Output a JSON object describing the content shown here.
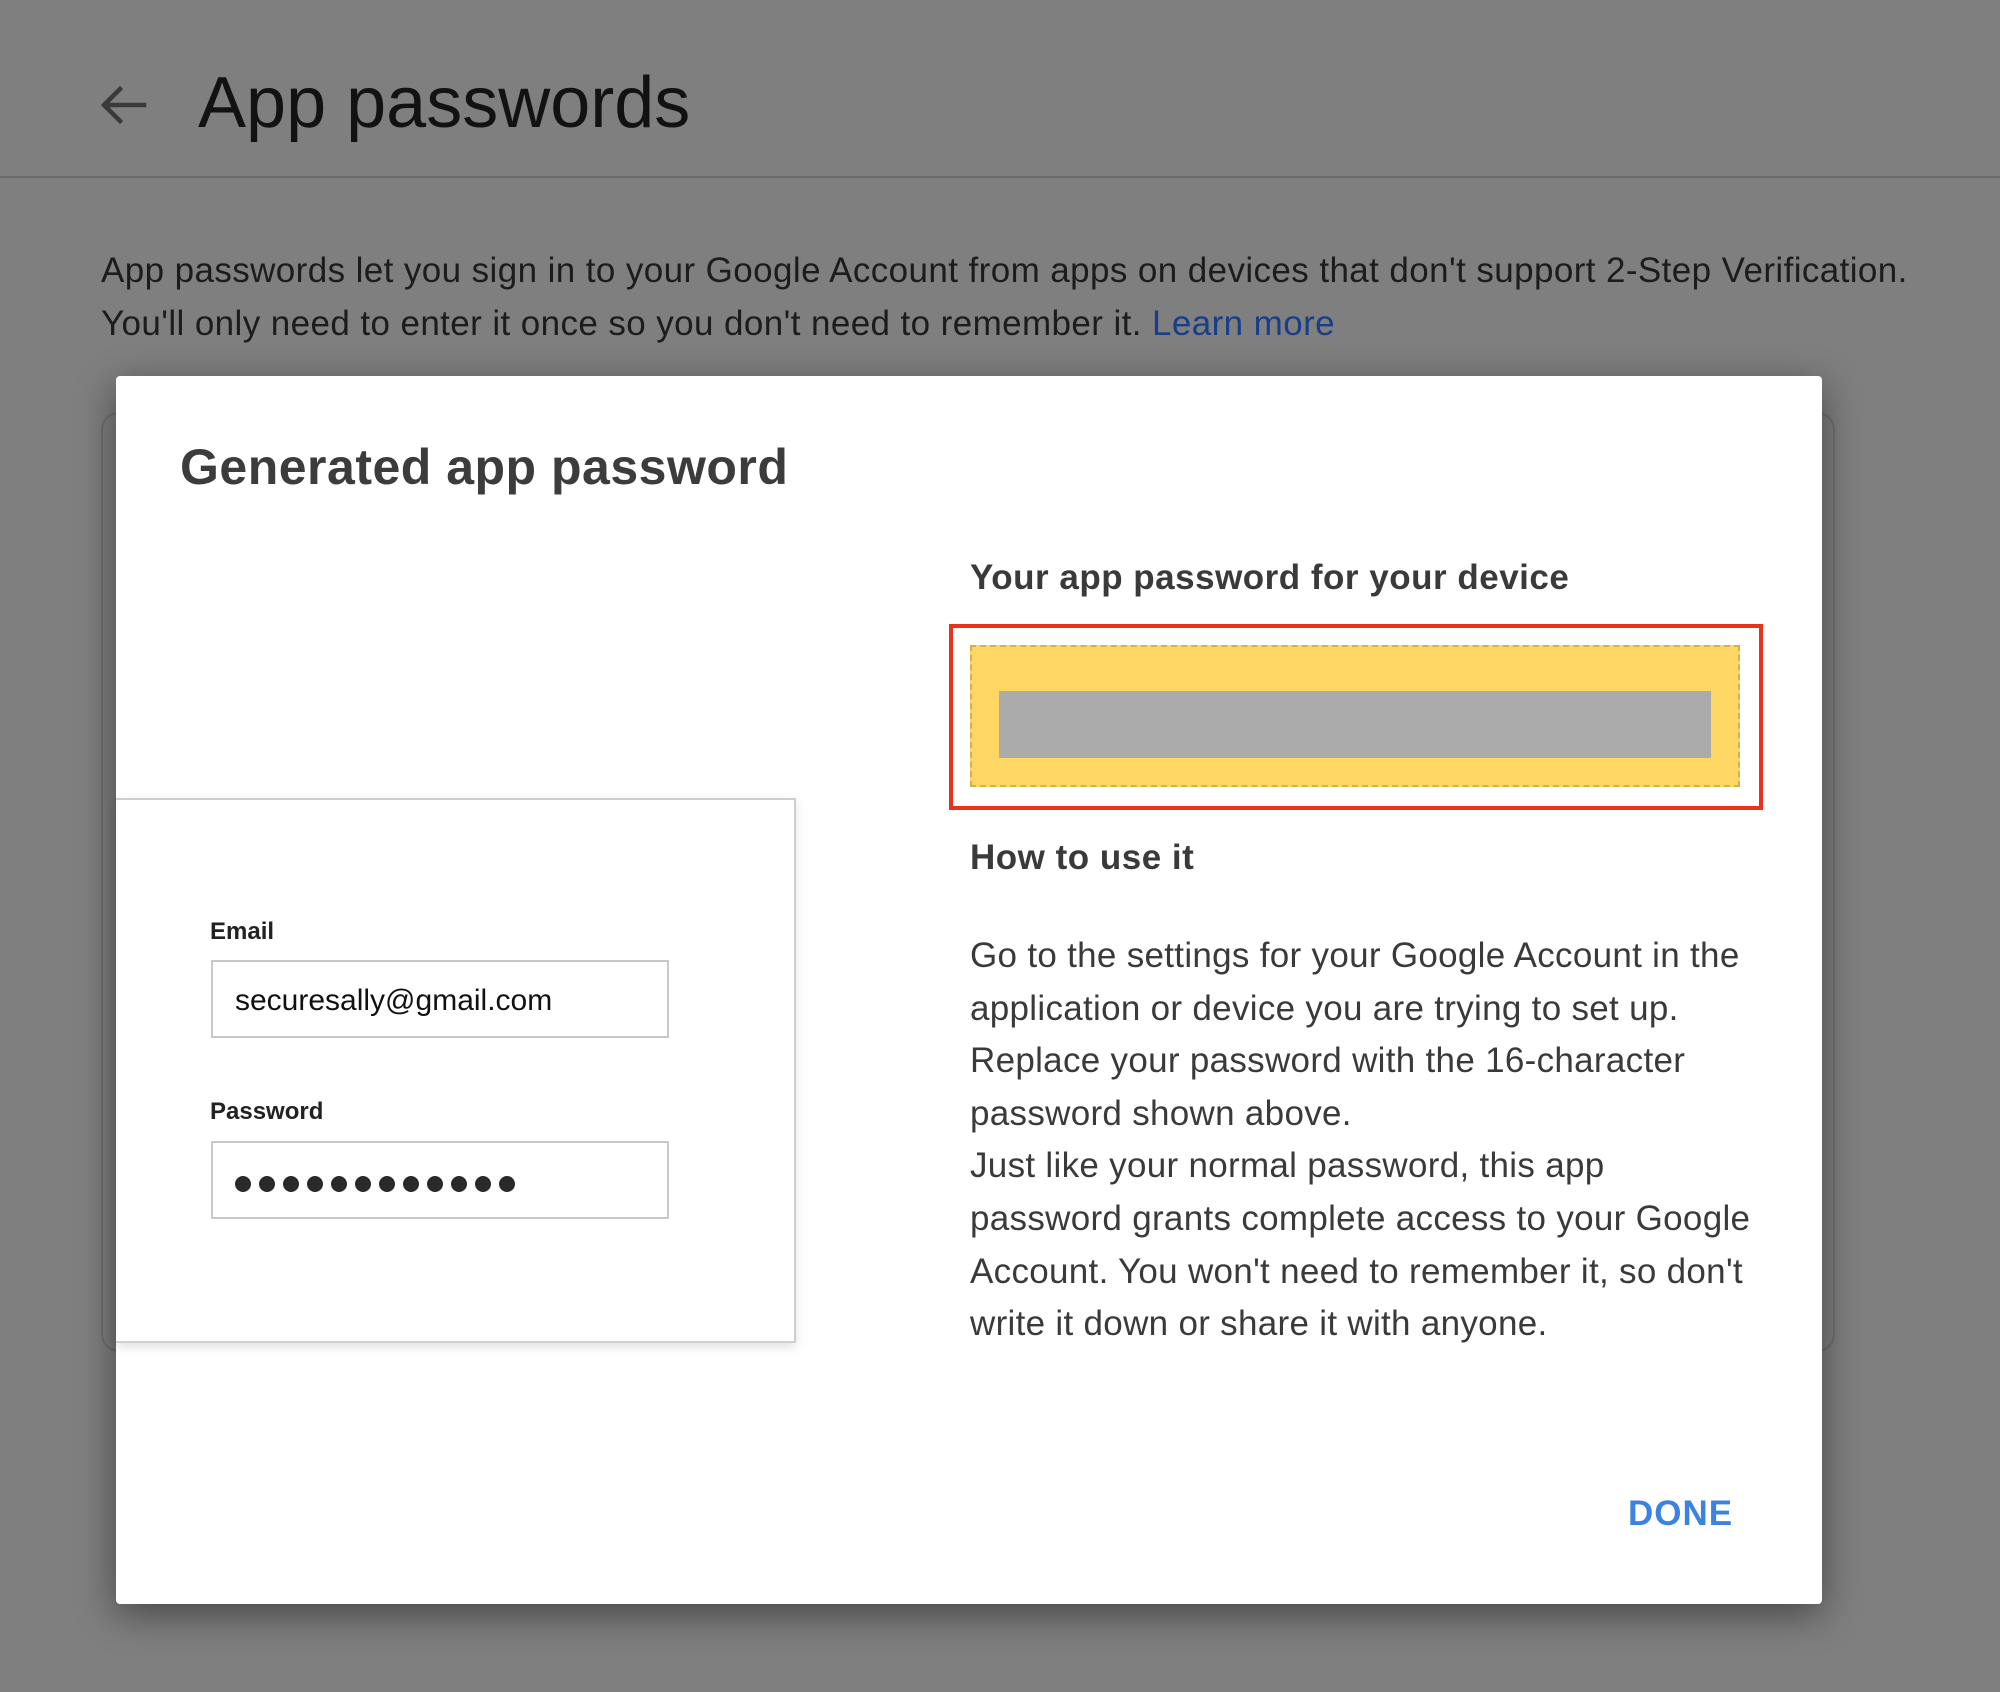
{
  "header": {
    "back_icon": "arrow-left-icon",
    "title": "App passwords"
  },
  "intro": {
    "text": "App passwords let you sign in to your Google Account from apps on devices that don't support 2-Step Verification. You'll only need to enter it once so you don't need to remember it.",
    "link_label": "Learn more"
  },
  "dialog": {
    "title": "Generated app password",
    "illustration": {
      "email_label": "Email",
      "email_value": "securesally@gmail.com",
      "password_label": "Password",
      "password_dot_count": 12
    },
    "password_heading": "Your app password for your device",
    "password_box": {
      "fill_color": "#fdd663",
      "highlight_color": "#e8321e",
      "value_redacted": true
    },
    "how_heading": "How to use it",
    "how_paragraph_1": "Go to the settings for your Google Account in the application or device you are trying to set up. Replace your password with the 16-character password shown above.",
    "how_paragraph_2": "Just like your normal password, this app password grants complete access to your Google Account. You won't need to remember it, so don't write it down or share it with anyone.",
    "done_label": "DONE"
  },
  "colors": {
    "overlay": "#7f7f7f",
    "link": "#173e8a",
    "accent": "#3c82e0"
  }
}
